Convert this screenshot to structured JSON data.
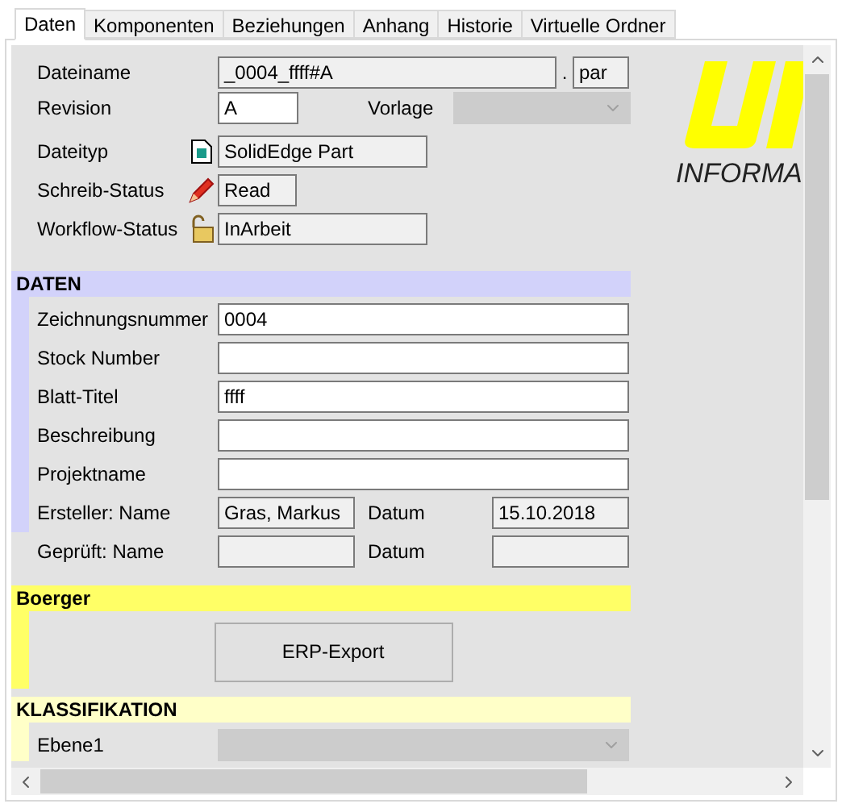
{
  "tabs": [
    {
      "label": "Daten",
      "selected": true
    },
    {
      "label": "Komponenten",
      "selected": false
    },
    {
      "label": "Beziehungen",
      "selected": false
    },
    {
      "label": "Anhang",
      "selected": false
    },
    {
      "label": "Historie",
      "selected": false
    },
    {
      "label": "Virtuelle Ordner",
      "selected": false
    }
  ],
  "general": {
    "dateiname": {
      "label": "Dateiname",
      "value": "_0004_ffff#A",
      "separator": ".",
      "extension": "par",
      "readonly": true
    },
    "revision": {
      "label": "Revision",
      "value": "A",
      "readonly": false
    },
    "vorlage": {
      "label": "Vorlage",
      "disabled": true
    },
    "status_rows": [
      {
        "label": "Dateityp",
        "value": "SolidEdge Part"
      },
      {
        "label": "Schreib-Status",
        "value": "Read"
      },
      {
        "label": "Workflow-Status",
        "value": "InArbeit"
      }
    ]
  },
  "logo": {
    "text": "INFORMA"
  },
  "sections": [
    {
      "title": "DATEN",
      "color": "#d2d2fa",
      "rows": [
        {
          "kind": "text",
          "label": "Zeichnungsnummer",
          "value": "0004",
          "readonly": false
        },
        {
          "kind": "text",
          "label": "Stock Number",
          "value": "",
          "readonly": false
        },
        {
          "kind": "text",
          "label": "Blatt-Titel",
          "value": "ffff",
          "readonly": false
        },
        {
          "kind": "text",
          "label": "Beschreibung",
          "value": "",
          "readonly": false
        },
        {
          "kind": "text",
          "label": "Projektname",
          "value": "",
          "readonly": false
        },
        {
          "kind": "pair",
          "label": "Ersteller: Name",
          "value": "Gras, Markus",
          "label2": "Datum",
          "value2": "15.10.2018"
        }
      ],
      "extra_rows": [
        {
          "kind": "pair",
          "label": "Geprüft: Name",
          "value": "",
          "label2": "Datum",
          "value2": ""
        }
      ]
    },
    {
      "title": "Boerger",
      "color": "#ffff66",
      "rows": [
        {
          "kind": "button",
          "label": "ERP-Export"
        }
      ]
    },
    {
      "title": "KLASSIFIKATION",
      "color": "#ffffc8",
      "rows": [
        {
          "kind": "dropdown",
          "label": "Ebene1",
          "disabled": true
        }
      ]
    }
  ]
}
